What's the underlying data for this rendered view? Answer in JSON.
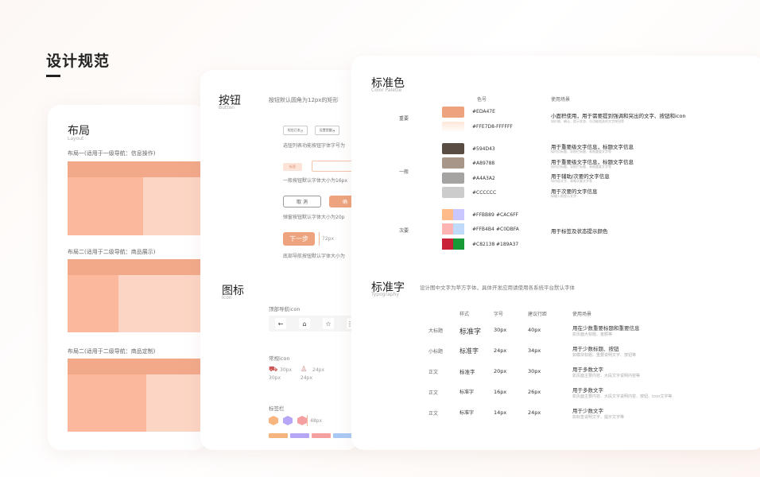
{
  "page": {
    "title": "设计规范"
  },
  "layout": {
    "title": "布局",
    "subtitle": "Layout",
    "sections": [
      {
        "label": "布局一(适用于一级导航：信息操作)"
      },
      {
        "label": "布局二(适用于二级导航：商品展示)"
      },
      {
        "label": "布局二(适用于二级导航：商品定制)"
      }
    ]
  },
  "buttons": {
    "title": "按钮",
    "subtitle": "Button",
    "desc": "按钮默认圆角为12px的矩形",
    "outline_btn_1": "短信已发 ",
    "outline_btn_2": "设置提醒 ",
    "note_1": "选钮列表功能按钮字体字号为",
    "small_label": "标签",
    "note_2": "一般按钮默认字体大小为16px",
    "cancel": "取 消",
    "confirm": "确",
    "note_3": "弹窗按钮默认字体大小为20p",
    "next": "下一步",
    "next_size": "72px",
    "note_4": "底部导航按钮默认字体大小为"
  },
  "icons": {
    "title": "图标",
    "subtitle": "Icon",
    "top_nav": "顶部导航icon",
    "normal": "常规icon",
    "size_30": "30px",
    "size_24": "24px",
    "tag_bar": "标签栏",
    "size_48": "48px"
  },
  "colors": {
    "title": "标准色",
    "subtitle": "Color Palette",
    "col_code": "色号",
    "col_use": "使用场景",
    "groups": {
      "primary": "重要",
      "normal": "一般",
      "secondary": "次要"
    },
    "rows": [
      {
        "hex": "#EDA47E",
        "color": "#EDA47E"
      },
      {
        "hex": "#FFE7D8-FFFFFF",
        "color": "#FFE7D8"
      },
      {
        "hex": "#594D43",
        "color": "#594D43"
      },
      {
        "hex": "#A89788",
        "color": "#A89788"
      },
      {
        "hex": "#A4A3A2",
        "color": "#A4A3A2"
      },
      {
        "hex": "#CCCCCC",
        "color": "#CCCCCC"
      }
    ],
    "pairs": [
      {
        "hex1": "#FFBB89",
        "hex2": "#CAC6FF",
        "c1": "#FFBB89",
        "c2": "#CAC6FF"
      },
      {
        "hex1": "#FFB4B4",
        "hex2": "#C0DBFA",
        "c1": "#FFB4B4",
        "c2": "#C0DBFA"
      },
      {
        "hex1": "#C82138",
        "hex2": "#189A37",
        "c1": "#C82138",
        "c2": "#189A37"
      }
    ],
    "uses": [
      {
        "main": "小面积使用，用于需要提到强调和突出的文字、按钮和icon",
        "sub": "如价格、确认、提示状态、与功能相关的文字按钮等"
      },
      {
        "main": "用于重要级文字信息，标题文字信息",
        "sub": "如内页标题、导航栏标题、表格重要文字等"
      },
      {
        "main": "用于重要级文字信息，标题文字信息",
        "sub": "如内页标题、导航栏标题、表格重要文字等"
      },
      {
        "main": "用于辅助/次要的文字信息",
        "sub": "如内容文字、表格次要文字等"
      },
      {
        "main": "用于次要的文字信息",
        "sub": "如输入框提示文字"
      },
      {
        "main": "用于标签及状态提示颜色",
        "sub": ""
      }
    ]
  },
  "typography": {
    "title": "标准字",
    "subtitle": "Typography",
    "desc": "设计图中文字为苹方字体，具体开发应用请使用各系统平台默认字体",
    "headers": {
      "style": "样式",
      "size": "字号",
      "line": "建议行距",
      "use": "使用场景"
    },
    "rows": [
      {
        "label": "大标题",
        "sample": "标准字",
        "size": "30px",
        "line": "40px",
        "use": "用在少数重要标题和重要信息",
        "sub": "如页面大标题、金额等"
      },
      {
        "label": "小标题",
        "sample": "标准字",
        "size": "24px",
        "line": "34px",
        "use": "用于少数标题、按钮",
        "sub": "如模块标题、重要说明文字、按钮等"
      },
      {
        "label": "正文",
        "sample": "标准字",
        "size": "20px",
        "line": "30px",
        "use": "用于多数文字",
        "sub": "如页面主要内容、大段文字说明内容等"
      },
      {
        "label": "正文",
        "sample": "标准字",
        "size": "16px",
        "line": "26px",
        "use": "用于多数文字",
        "sub": "如页面主要内容、大段文字说明内容、按钮、icon文字等"
      },
      {
        "label": "正文",
        "sample": "标准字",
        "size": "14px",
        "line": "24px",
        "use": "用于少数文字",
        "sub": "如标签说明文字、提示文字等"
      }
    ]
  }
}
